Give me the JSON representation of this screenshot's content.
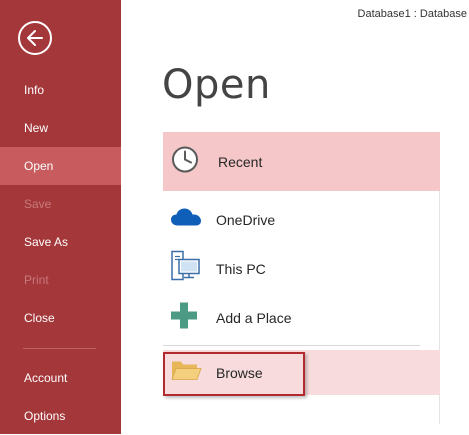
{
  "window": {
    "title": "Database1 : Database"
  },
  "sidebar": {
    "back_icon": "back-arrow-icon",
    "items": [
      {
        "label": "Info",
        "state": "normal"
      },
      {
        "label": "New",
        "state": "normal"
      },
      {
        "label": "Open",
        "state": "selected"
      },
      {
        "label": "Save",
        "state": "disabled"
      },
      {
        "label": "Save As",
        "state": "normal"
      },
      {
        "label": "Print",
        "state": "disabled"
      },
      {
        "label": "Close",
        "state": "normal"
      },
      {
        "label": "Account",
        "state": "normal"
      },
      {
        "label": "Options",
        "state": "normal"
      }
    ]
  },
  "main": {
    "title": "Open",
    "locations": [
      {
        "label": "Recent",
        "icon": "clock-icon",
        "state": "selected"
      },
      {
        "label": "OneDrive",
        "icon": "cloud-icon",
        "state": "normal"
      },
      {
        "label": "This PC",
        "icon": "computer-icon",
        "state": "normal"
      },
      {
        "label": "Add a Place",
        "icon": "plus-icon",
        "state": "normal"
      },
      {
        "label": "Browse",
        "icon": "folder-icon",
        "state": "hover"
      }
    ]
  },
  "colors": {
    "sidebar_bg": "#a4373a",
    "sidebar_selected": "#c75b5d",
    "recent_bg": "#f5c7c8",
    "browse_bg": "#f8dcdd",
    "highlight_border": "#b02a30"
  }
}
